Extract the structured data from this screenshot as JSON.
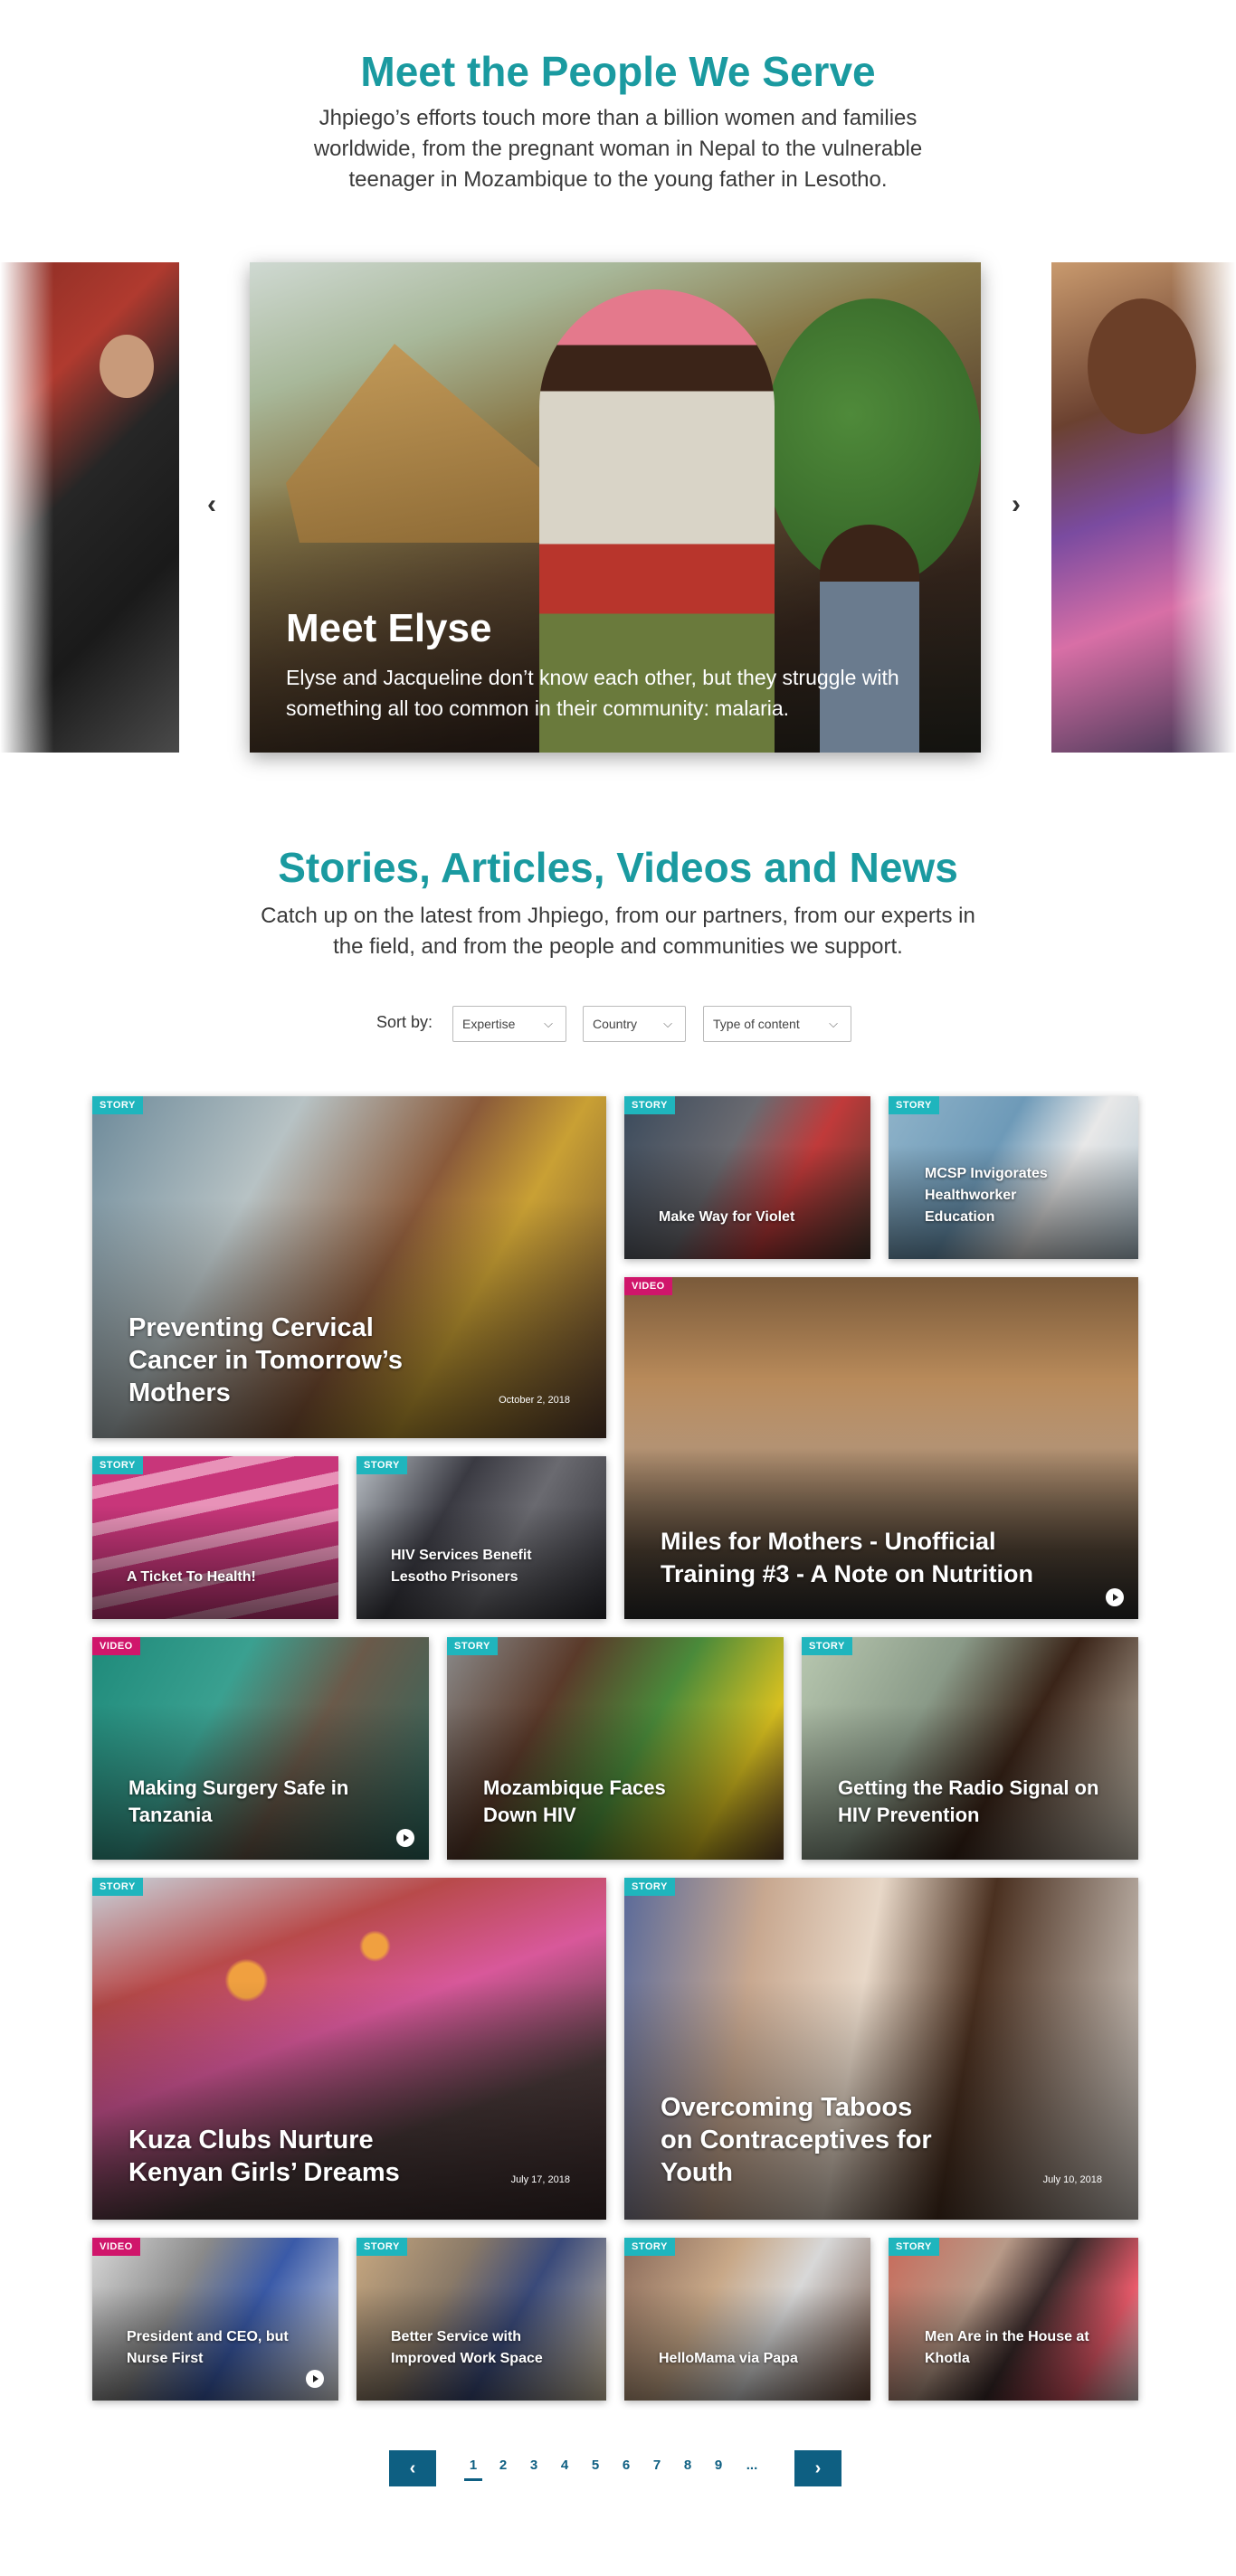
{
  "hero": {
    "title": "Meet the People We Serve",
    "subtitle": "Jhpiego’s efforts touch more than a billion women and families worldwide, from the pregnant woman in Nepal to the vulnerable teenager in Mozambique to the young father in Lesotho."
  },
  "carousel": {
    "prev_icon": "chevron-left-icon",
    "next_icon": "chevron-right-icon",
    "prev_glyph": "‹",
    "next_glyph": "›",
    "active_slide": {
      "title": "Meet Elyse",
      "description": "Elyse and Jacqueline don’t know each other, but they struggle with something all too common in their community: malaria."
    }
  },
  "stories": {
    "title": "Stories, Articles, Videos and News",
    "subtitle": "Catch up on the latest from Jhpiego, from our partners, from our experts in the field, and from the people and communities we support."
  },
  "sort": {
    "label": "Sort by:",
    "filters": [
      "Expertise",
      "Country",
      "Type of content"
    ],
    "chevron": "⌵"
  },
  "cards": [
    {
      "type": "STORY",
      "title": "Preventing Cervical Cancer in Tomorrow’s Mothers",
      "date": "October 2, 2018"
    },
    {
      "type": "STORY",
      "title": "Make Way for Violet"
    },
    {
      "type": "STORY",
      "title": "MCSP Invigorates Healthworker Education"
    },
    {
      "type": "VIDEO",
      "title": "Miles for Mothers - Unofficial Training #3 - A Note on Nutrition"
    },
    {
      "type": "STORY",
      "title": "A Ticket To Health!"
    },
    {
      "type": "STORY",
      "title": "HIV Services Benefit Lesotho Prisoners"
    },
    {
      "type": "VIDEO",
      "title": "Making Surgery Safe in Tanzania"
    },
    {
      "type": "STORY",
      "title": "Mozambique Faces Down HIV"
    },
    {
      "type": "STORY",
      "title": "Getting the Radio Signal on HIV Prevention"
    },
    {
      "type": "STORY",
      "title": "Kuza Clubs Nurture Kenyan Girls’ Dreams",
      "date": "July 17, 2018"
    },
    {
      "type": "STORY",
      "title": "Overcoming Taboos on Contraceptives for Youth",
      "date": "July 10, 2018"
    },
    {
      "type": "VIDEO",
      "title": "President and CEO, but Nurse First"
    },
    {
      "type": "STORY",
      "title": "Better Service with Improved Work Space"
    },
    {
      "type": "STORY",
      "title": "HelloMama via Papa"
    },
    {
      "type": "STORY",
      "title": "Men Are in the House at Khotla"
    }
  ],
  "pagination": {
    "prev_glyph": "‹",
    "next_glyph": "›",
    "pages": [
      "1",
      "2",
      "3",
      "4",
      "5",
      "6",
      "7",
      "8",
      "9",
      "..."
    ],
    "current_page": "1"
  },
  "colors": {
    "accent": "#1a9aa0",
    "story_badge": "#1fb5bd",
    "video_badge": "#d0166b",
    "pager": "#0e5f82"
  }
}
